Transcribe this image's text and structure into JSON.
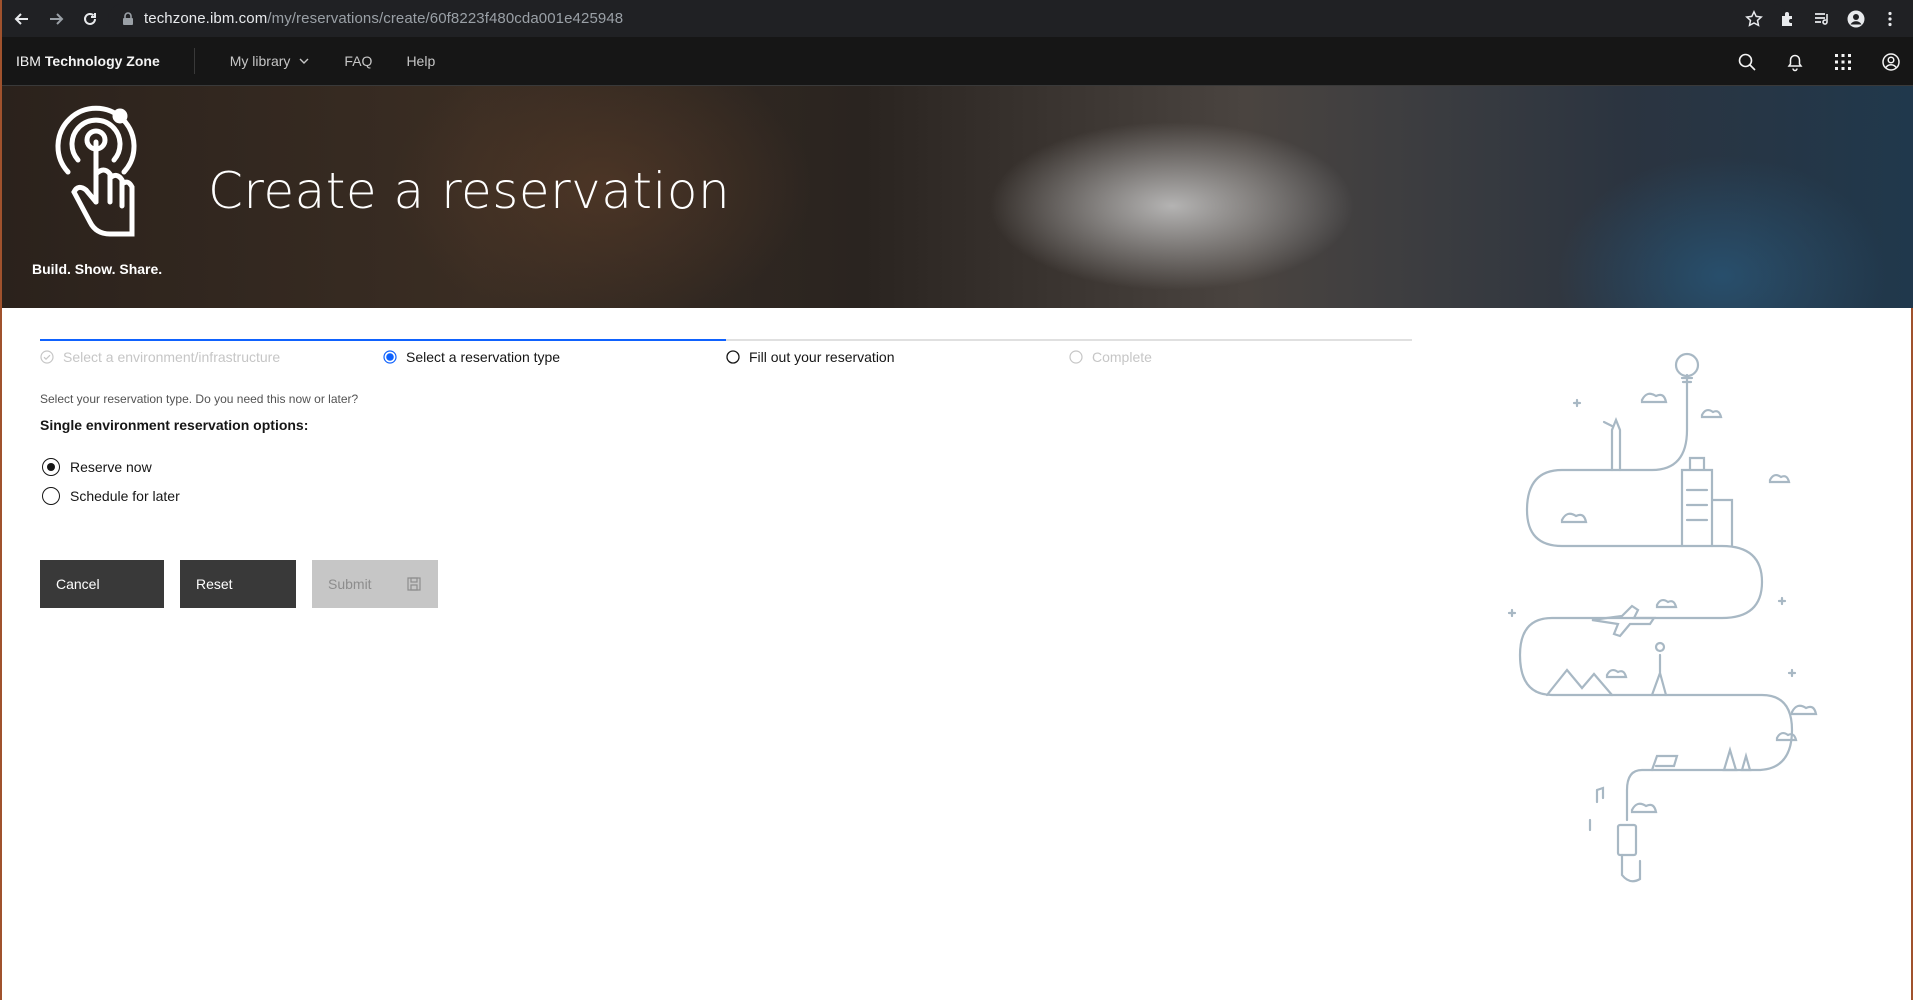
{
  "browser": {
    "url_host": "techzone.ibm.com",
    "url_path": "/my/reservations/create/60f8223f480cda001e425948"
  },
  "header": {
    "brand_prefix": "IBM",
    "brand_name": "Technology Zone",
    "nav": [
      {
        "label": "My library"
      },
      {
        "label": "FAQ"
      },
      {
        "label": "Help"
      }
    ]
  },
  "hero": {
    "title": "Create a reservation",
    "tagline": "Build. Show. Share."
  },
  "progress": {
    "steps": [
      {
        "label": "Select a environment/infrastructure",
        "state": "complete"
      },
      {
        "label": "Select a reservation type",
        "state": "current"
      },
      {
        "label": "Fill out your reservation",
        "state": "incomplete"
      },
      {
        "label": "Complete",
        "state": "disabled"
      }
    ]
  },
  "form": {
    "helper_text": "Select your reservation type. Do you need this now or later?",
    "legend": "Single environment reservation options:",
    "options": [
      {
        "label": "Reserve now",
        "selected": true
      },
      {
        "label": "Schedule for later",
        "selected": false
      }
    ],
    "buttons": {
      "cancel": "Cancel",
      "reset": "Reset",
      "submit": "Submit"
    }
  },
  "colors": {
    "accent": "#0f62fe",
    "header_bg": "#161616",
    "button_dark": "#393939",
    "button_disabled": "#c6c6c6"
  }
}
